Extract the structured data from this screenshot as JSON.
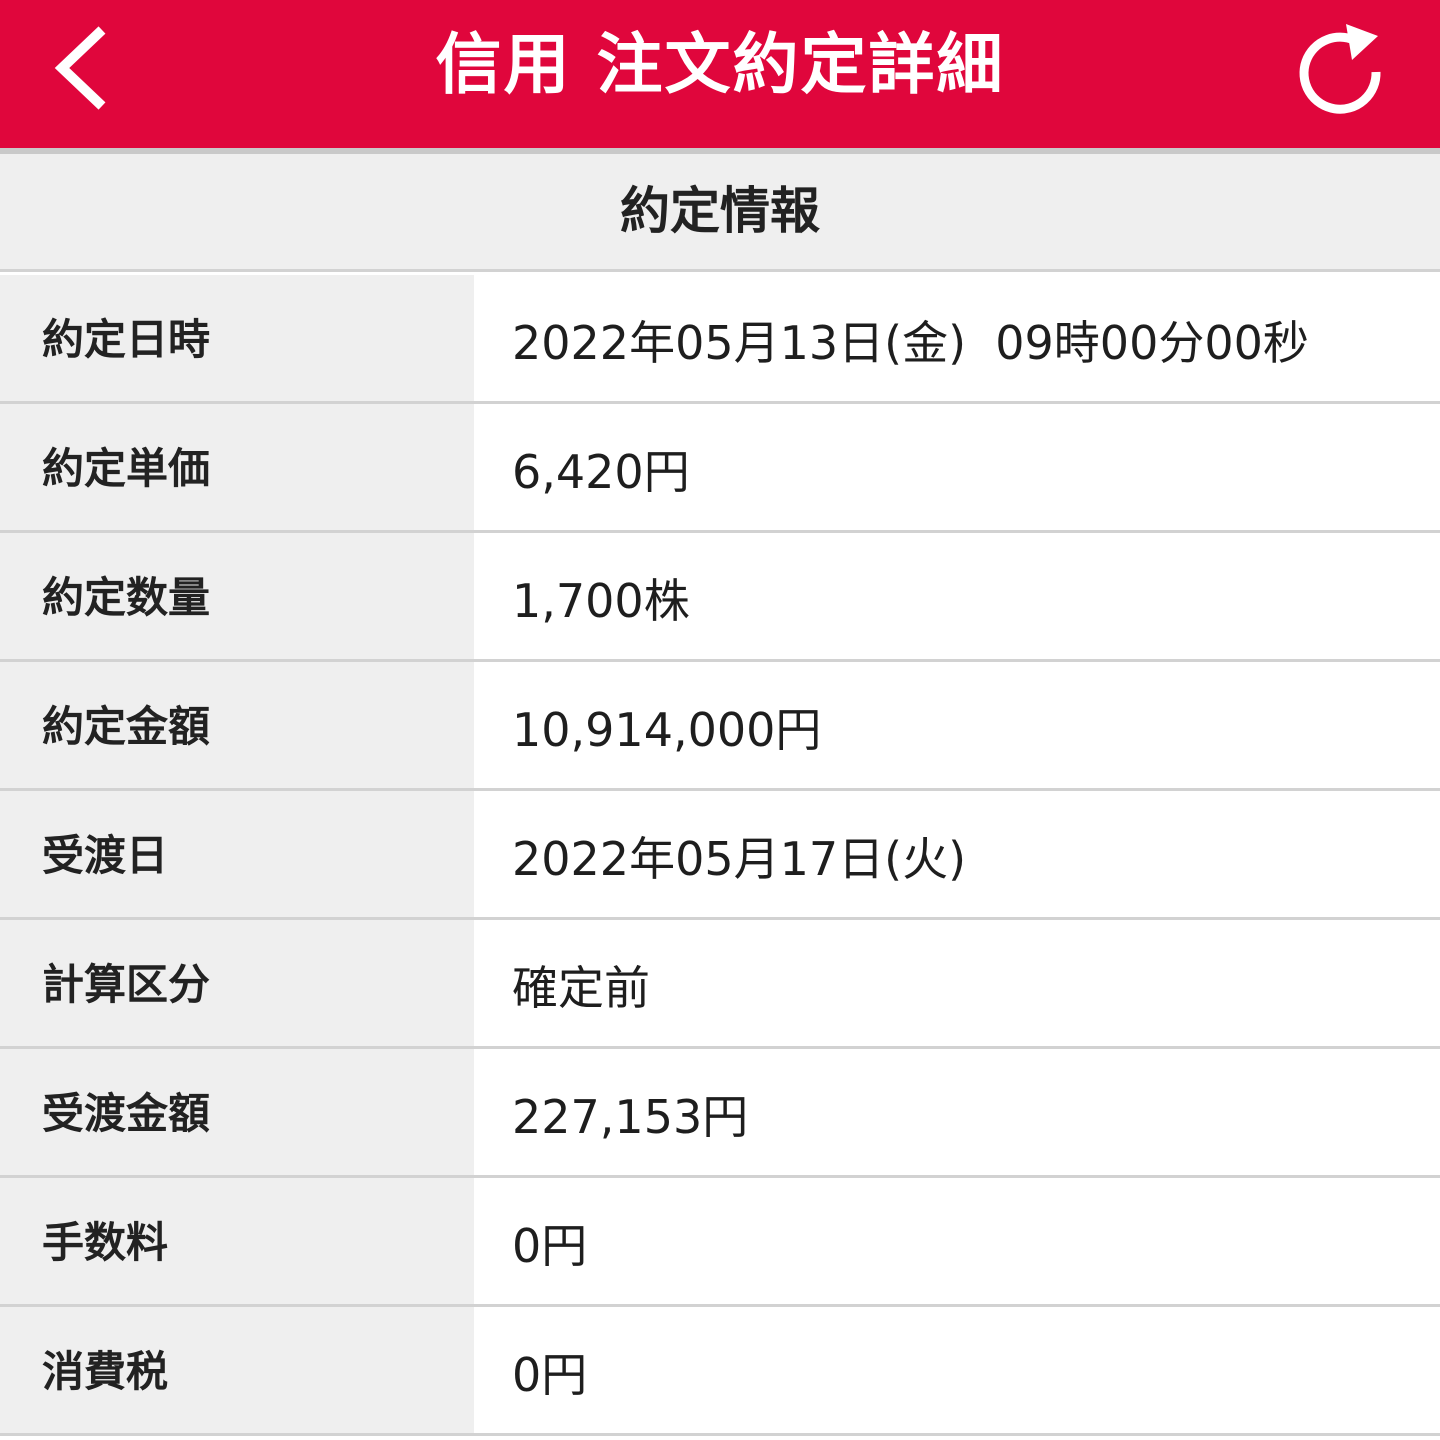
{
  "colors": {
    "header_background": "#e0063c",
    "header_text": "#ffffff",
    "label_background": "#efefef",
    "value_background": "#ffffff",
    "divider": "#d2d2d2"
  },
  "header": {
    "title": "信用 注文約定詳細",
    "back_icon": "chevron-left-icon",
    "refresh_icon": "refresh-icon"
  },
  "section": {
    "title": "約定情報"
  },
  "rows": [
    {
      "label": "約定日時",
      "value": "2022年05月13日(金)  09時00分00秒"
    },
    {
      "label": "約定単価",
      "value": "6,420円"
    },
    {
      "label": "約定数量",
      "value": "1,700株"
    },
    {
      "label": "約定金額",
      "value": "10,914,000円"
    },
    {
      "label": "受渡日",
      "value": "2022年05月17日(火)"
    },
    {
      "label": "計算区分",
      "value": "確定前"
    },
    {
      "label": "受渡金額",
      "value": "227,153円"
    },
    {
      "label": "手数料",
      "value": "0円"
    },
    {
      "label": "消費税",
      "value": "0円"
    }
  ]
}
